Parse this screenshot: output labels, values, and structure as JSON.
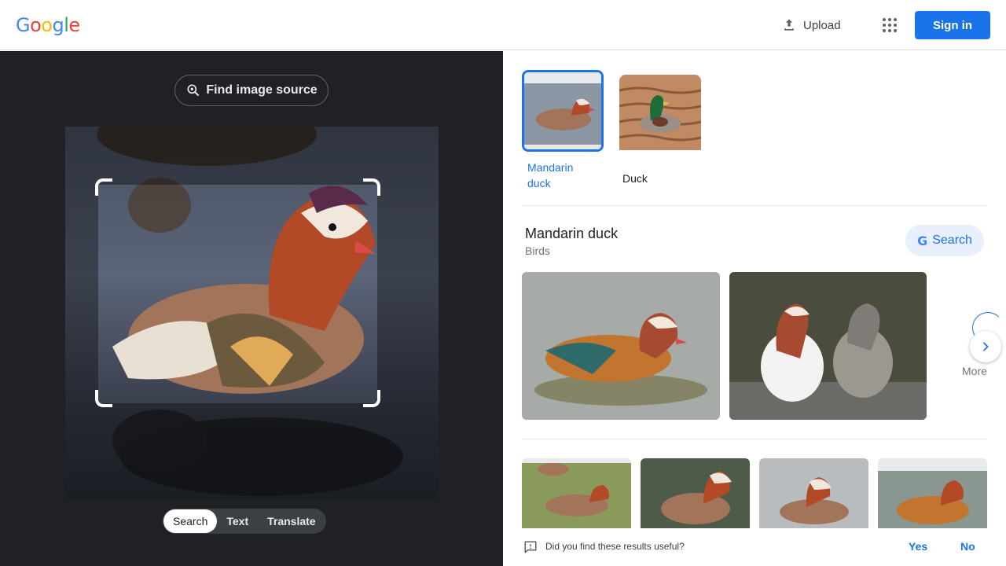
{
  "header": {
    "logo_letters": [
      {
        "ch": "G",
        "color": "#4285F4"
      },
      {
        "ch": "o",
        "color": "#EA4335"
      },
      {
        "ch": "o",
        "color": "#FBBC05"
      },
      {
        "ch": "g",
        "color": "#4285F4"
      },
      {
        "ch": "l",
        "color": "#34A853"
      },
      {
        "ch": "e",
        "color": "#EA4335"
      }
    ],
    "upload_label": "Upload",
    "upload_icon": "upload-icon",
    "apps_icon": "apps-grid-icon",
    "signin_label": "Sign in"
  },
  "left": {
    "find_source_label": "Find image source",
    "find_source_icon": "lens-search-icon",
    "modes": [
      "Search",
      "Text",
      "Translate"
    ],
    "active_mode": "Search"
  },
  "right": {
    "chips": [
      {
        "label": "Mandarin duck",
        "selected": true
      },
      {
        "label": "Duck",
        "selected": false
      }
    ],
    "entity": {
      "title": "Mandarin duck",
      "subtitle": "Birds",
      "search_label": "Search"
    },
    "more_label": "More",
    "more_icon": "chevron-right-icon"
  },
  "feedback": {
    "question": "Did you find these results useful?",
    "yes_label": "Yes",
    "no_label": "No",
    "icon": "feedback-icon"
  },
  "colors": {
    "accent": "#1a73e8",
    "dark_bg": "#202124"
  }
}
